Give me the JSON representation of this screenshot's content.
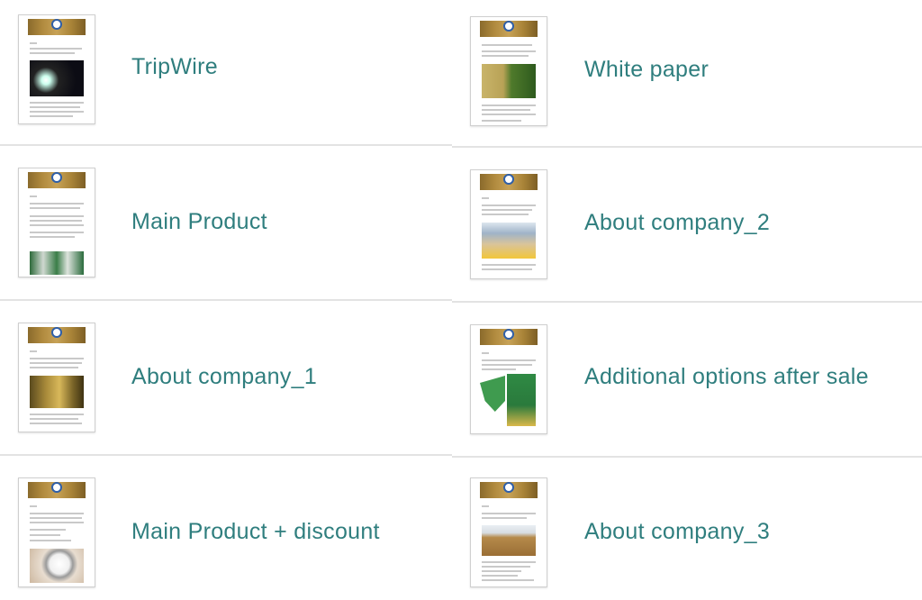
{
  "items": [
    {
      "label": "TripWire",
      "photo": "night-flashlight"
    },
    {
      "label": "White paper",
      "photo": "corn-field"
    },
    {
      "label": "Main Product",
      "photo": "factory-workers"
    },
    {
      "label": "About company_2",
      "photo": "kids-in-field"
    },
    {
      "label": "About company_1",
      "photo": "wheat-close-up"
    },
    {
      "label": "Additional options after sale",
      "photo": "green-machine"
    },
    {
      "label": "Main Product + discount",
      "photo": "alarm-clock"
    },
    {
      "label": "About company_3",
      "photo": "harvest-field"
    }
  ],
  "colors": {
    "label_text": "#2f7e7e",
    "divider": "#e3e3e3",
    "banner": "#b08a3e"
  }
}
